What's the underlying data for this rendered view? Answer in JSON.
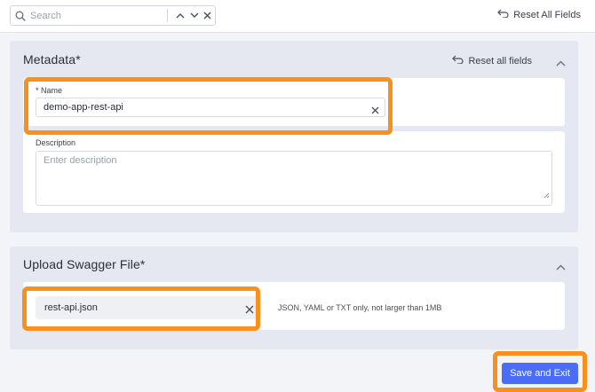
{
  "search": {
    "placeholder": "Search",
    "value": ""
  },
  "toolbar": {
    "reset_all_label": "Reset All Fields"
  },
  "metadata": {
    "title": "Metadata",
    "required_marker": "*",
    "reset_label": "Reset all fields",
    "name_label": "* Name",
    "name_value": "demo-app-rest-api",
    "description_label": "Description",
    "description_placeholder": "Enter description",
    "description_value": ""
  },
  "upload": {
    "title": "Upload Swagger File",
    "required_marker": "*",
    "file_name": "rest-api.json",
    "hint": "JSON, YAML or TXT only, not larger than 1MB"
  },
  "actions": {
    "save_label": "Save and Exit"
  },
  "colors": {
    "accent": "#4a6cf7",
    "highlight": "#f7901e",
    "panel_bg": "#e5e7f1"
  },
  "icons": [
    "search-icon",
    "chevron-up-icon",
    "chevron-down-icon",
    "close-icon",
    "undo-icon",
    "resize-grip-icon"
  ]
}
